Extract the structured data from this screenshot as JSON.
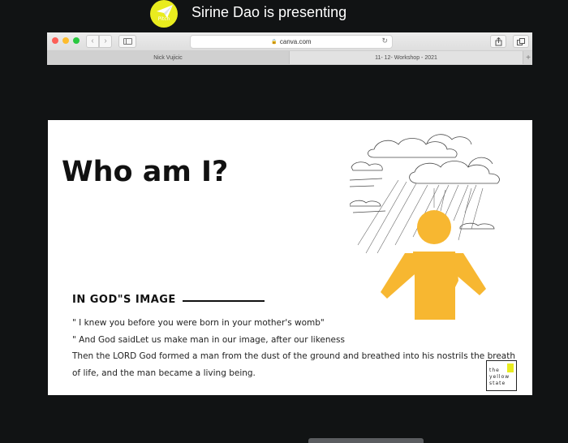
{
  "presenter": {
    "avatar_text": "Pitch",
    "status": "Sirine Dao is presenting"
  },
  "browser": {
    "url": "canva.com",
    "tabs": [
      {
        "label": "Nick Vujicic"
      },
      {
        "label": "11- 12- Workshop - 2021"
      }
    ],
    "new_tab_label": "+",
    "back_glyph": "‹",
    "forward_glyph": "›"
  },
  "slide": {
    "title": "Who am I?",
    "section_heading": "IN GOD\"S IMAGE",
    "lines": [
      "\" I knew you before you were born in your mother's womb\"",
      "\" And God saidLet us make man in our image, after our likeness",
      "Then the LORD God formed a man from the dust of the ground and breathed into his nostrils the breath",
      "of life, and the man became a living being."
    ],
    "logo": {
      "line1": "the",
      "line2": "yellow",
      "line3": "state"
    }
  },
  "colors": {
    "figure": "#f7b731",
    "accent": "#e9ec1e",
    "background": "#111314"
  },
  "icons": [
    "paper-plane-icon",
    "lock-icon",
    "reload-icon",
    "share-icon",
    "tabs-icon",
    "sidebar-icon"
  ]
}
